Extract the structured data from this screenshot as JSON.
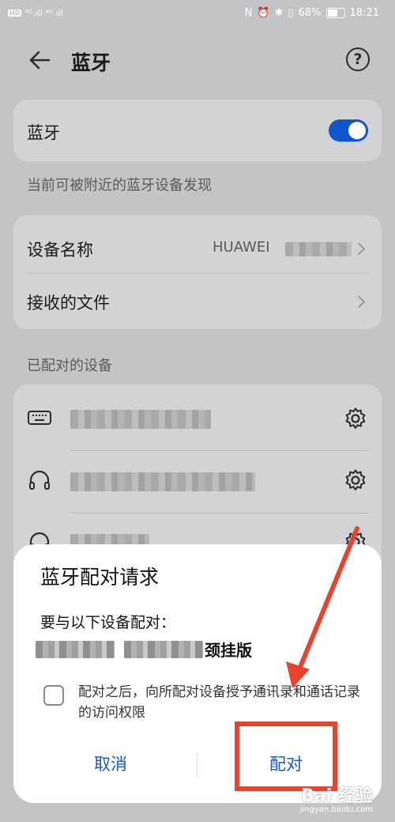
{
  "status_bar": {
    "left_hd": "HD",
    "left_signal": "⁴ᴳ.ıll ⁴ᴳ.ıll",
    "battery": "68%",
    "time": "18:21"
  },
  "header": {
    "title": "蓝牙",
    "back_icon": "back-arrow-icon",
    "help_icon": "help-icon",
    "help_glyph": "?"
  },
  "bluetooth_card": {
    "label": "蓝牙",
    "toggle_state": "on",
    "accent": "#1155cc"
  },
  "visibility_hint": "当前可被附近的蓝牙设备发现",
  "device_info": {
    "name_label": "设备名称",
    "name_value": "HUAWEI",
    "received_files_label": "接收的文件"
  },
  "paired_section": {
    "label": "已配对的设备",
    "devices": [
      {
        "icon": "keyboard-icon"
      },
      {
        "icon": "headset-icon"
      },
      {
        "icon": "headset-icon"
      }
    ]
  },
  "dialog": {
    "title": "蓝牙配对请求",
    "message": "要与以下设备配对：",
    "device_suffix": "颈挂版",
    "permission_text": "配对之后，向所配对设备授予通讯录和通话记录的访问权限",
    "checkbox_checked": false,
    "cancel_label": "取消",
    "pair_label": "配对",
    "button_color": "#1a55d0"
  },
  "annotation": {
    "highlight_color": "#e8432f"
  },
  "watermark": {
    "text": "Bai 经验",
    "sub": "jingyan.baidu.com"
  }
}
